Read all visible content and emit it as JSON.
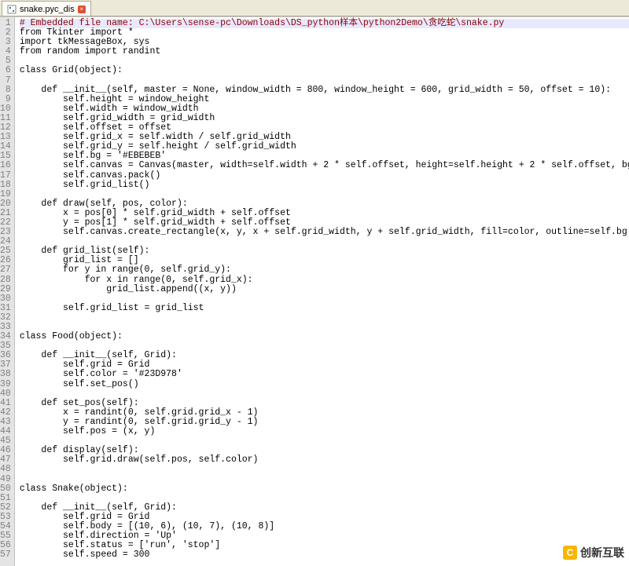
{
  "tab": {
    "title": "snake.pyc_dis",
    "close_glyph": "×"
  },
  "gutter": {
    "start": 1,
    "end": 57
  },
  "watermark": {
    "text": "创新互联",
    "icon_letter": "C"
  },
  "code_lines": [
    {
      "cls": "red hl-line",
      "text": "# Embedded file name: C:\\Users\\sense-pc\\Downloads\\DS_python样本\\python2Demo\\贪吃蛇\\snake.py"
    },
    {
      "text": "from Tkinter import *"
    },
    {
      "text": "import tkMessageBox, sys"
    },
    {
      "text": "from random import randint"
    },
    {
      "text": ""
    },
    {
      "text": "class Grid(object):"
    },
    {
      "text": ""
    },
    {
      "text": "    def __init__(self, master = None, window_width = 800, window_height = 600, grid_width = 50, offset = 10):"
    },
    {
      "text": "        self.height = window_height"
    },
    {
      "text": "        self.width = window_width"
    },
    {
      "text": "        self.grid_width = grid_width"
    },
    {
      "text": "        self.offset = offset"
    },
    {
      "text": "        self.grid_x = self.width / self.grid_width"
    },
    {
      "text": "        self.grid_y = self.height / self.grid_width"
    },
    {
      "text": "        self.bg = '#EBEBEB'"
    },
    {
      "text": "        self.canvas = Canvas(master, width=self.width + 2 * self.offset, height=self.height + 2 * self.offset, bg=self.bg)"
    },
    {
      "text": "        self.canvas.pack()"
    },
    {
      "text": "        self.grid_list()"
    },
    {
      "text": ""
    },
    {
      "text": "    def draw(self, pos, color):"
    },
    {
      "text": "        x = pos[0] * self.grid_width + self.offset"
    },
    {
      "text": "        y = pos[1] * self.grid_width + self.offset"
    },
    {
      "text": "        self.canvas.create_rectangle(x, y, x + self.grid_width, y + self.grid_width, fill=color, outline=self.bg)"
    },
    {
      "text": ""
    },
    {
      "text": "    def grid_list(self):"
    },
    {
      "text": "        grid_list = []"
    },
    {
      "text": "        for y in range(0, self.grid_y):"
    },
    {
      "text": "            for x in range(0, self.grid_x):"
    },
    {
      "text": "                grid_list.append((x, y))"
    },
    {
      "text": ""
    },
    {
      "text": "        self.grid_list = grid_list"
    },
    {
      "text": ""
    },
    {
      "text": ""
    },
    {
      "text": "class Food(object):"
    },
    {
      "text": ""
    },
    {
      "text": "    def __init__(self, Grid):"
    },
    {
      "text": "        self.grid = Grid"
    },
    {
      "text": "        self.color = '#23D978'"
    },
    {
      "text": "        self.set_pos()"
    },
    {
      "text": ""
    },
    {
      "text": "    def set_pos(self):"
    },
    {
      "text": "        x = randint(0, self.grid.grid_x - 1)"
    },
    {
      "text": "        y = randint(0, self.grid.grid_y - 1)"
    },
    {
      "text": "        self.pos = (x, y)"
    },
    {
      "text": ""
    },
    {
      "text": "    def display(self):"
    },
    {
      "text": "        self.grid.draw(self.pos, self.color)"
    },
    {
      "text": ""
    },
    {
      "text": ""
    },
    {
      "text": "class Snake(object):"
    },
    {
      "text": ""
    },
    {
      "text": "    def __init__(self, Grid):"
    },
    {
      "text": "        self.grid = Grid"
    },
    {
      "text": "        self.body = [(10, 6), (10, 7), (10, 8)]"
    },
    {
      "text": "        self.direction = 'Up'"
    },
    {
      "text": "        self.status = ['run', 'stop']"
    },
    {
      "text": "        self.speed = 300"
    }
  ]
}
